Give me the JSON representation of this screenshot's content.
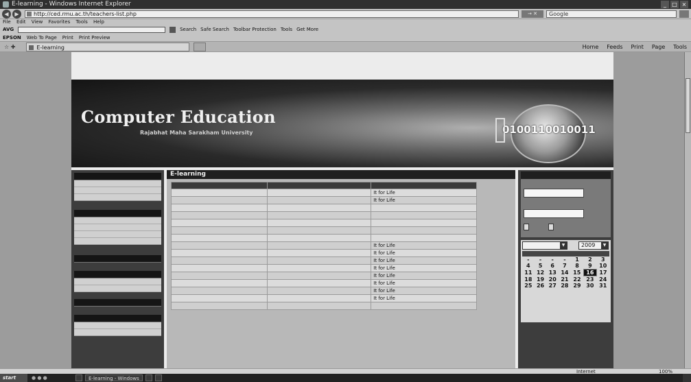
{
  "window": {
    "title": "E-learning - Windows Internet Explorer",
    "min": "_",
    "max": "□",
    "close": "×"
  },
  "address": {
    "url": "http://ced.rmu.ac.th/teachers-list.php",
    "go": "→ ✕",
    "search_placeholder": "Google"
  },
  "menu": [
    "File",
    "Edit",
    "View",
    "Favorites",
    "Tools",
    "Help"
  ],
  "toolbar1": {
    "label": "AVG",
    "search_value": "",
    "items": [
      "Search",
      "Safe Search",
      "Toolbar Protection",
      "Tools",
      "Get More"
    ]
  },
  "toolbar2": {
    "label": "EPSON",
    "items": [
      "Web To Page",
      "Print",
      "Print Preview"
    ]
  },
  "tab": {
    "label": "E-learning",
    "tools": [
      "Home",
      "Feeds",
      "Print",
      "Page",
      "Tools"
    ]
  },
  "site": {
    "top_links": "",
    "title": "Computer Education",
    "subtitle": "Rajabhat Maha Sarakham University",
    "nav": ""
  },
  "left_menu": [
    {
      "header": "",
      "items": [
        "",
        "",
        ""
      ]
    },
    {
      "header": "",
      "items": [
        "",
        "",
        "",
        ""
      ]
    },
    {
      "header": "",
      "items": []
    },
    {
      "header": "",
      "items": [
        "",
        ""
      ]
    },
    {
      "header": "",
      "items": []
    },
    {
      "header": "",
      "items": [
        "",
        ""
      ]
    }
  ],
  "main": {
    "heading": "E-learning",
    "columns": [
      "",
      "",
      ""
    ],
    "rows": [
      [
        "",
        "",
        "It for Life"
      ],
      [
        "",
        "",
        "It for Life"
      ],
      [
        "",
        "",
        ""
      ],
      [
        "",
        "",
        ""
      ],
      [
        "",
        "",
        ""
      ],
      [
        "",
        "",
        ""
      ],
      [
        "",
        "",
        ""
      ],
      [
        "",
        "",
        "It for Life"
      ],
      [
        "",
        "",
        "It for Life"
      ],
      [
        "",
        "",
        "It for Life"
      ],
      [
        "",
        "",
        "It for Life"
      ],
      [
        "",
        "",
        "It for Life"
      ],
      [
        "",
        "",
        "It for Life"
      ],
      [
        "",
        "",
        "It for Life"
      ],
      [
        "",
        "",
        "It for Life"
      ],
      [
        "",
        "",
        ""
      ]
    ]
  },
  "login": {
    "header": "",
    "user_label": "",
    "pass_label": "",
    "login_btn": "",
    "register_btn": ""
  },
  "calendar": {
    "month": "",
    "year": "2009",
    "days_header": [
      "",
      "",
      "",
      "",
      "",
      "",
      ""
    ],
    "weeks": [
      [
        "-",
        "-",
        "-",
        "-",
        "1",
        "2",
        "3"
      ],
      [
        "4",
        "5",
        "6",
        "7",
        "8",
        "9",
        "10"
      ],
      [
        "11",
        "12",
        "13",
        "14",
        "15",
        "16",
        "17"
      ],
      [
        "18",
        "19",
        "20",
        "21",
        "22",
        "23",
        "24"
      ],
      [
        "25",
        "26",
        "27",
        "28",
        "29",
        "30",
        "31"
      ]
    ],
    "today": "16"
  },
  "status": {
    "zone": "Internet",
    "zoom": "100%"
  },
  "taskbar": {
    "start": "start",
    "tasks": [
      "",
      "E-learning - Windows",
      "",
      ""
    ],
    "tray": ""
  }
}
